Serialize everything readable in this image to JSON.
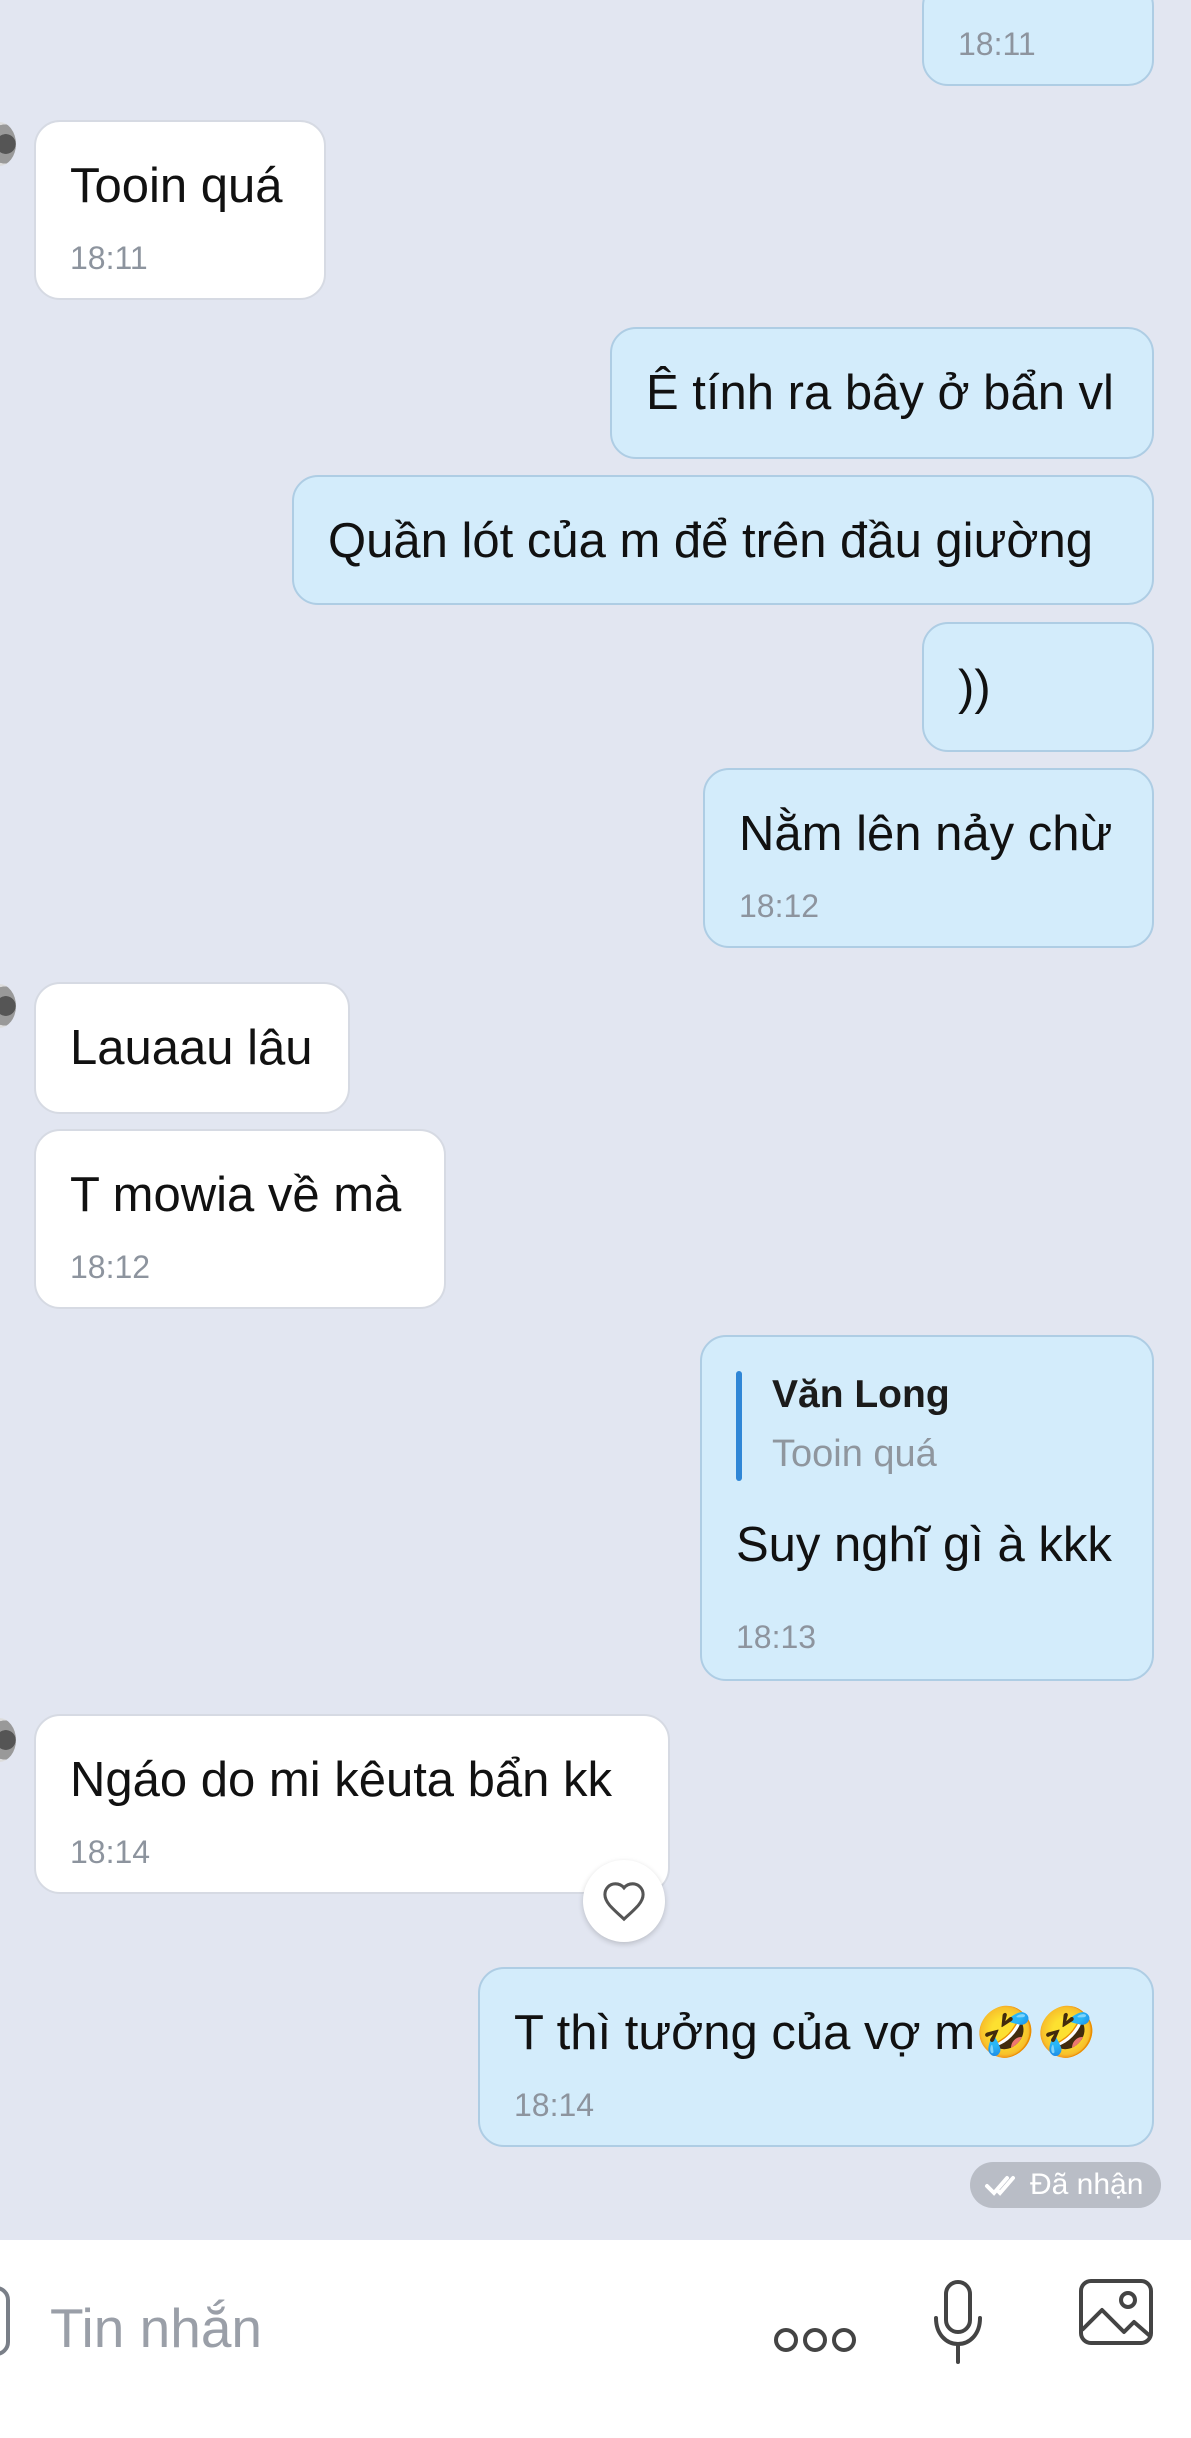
{
  "messages": [
    {
      "dir": "out",
      "time": "18:11"
    },
    {
      "dir": "in",
      "text": "Tooin quá",
      "time": "18:11"
    },
    {
      "dir": "out",
      "text": "Ê tính ra bây ở bẩn vl"
    },
    {
      "dir": "out",
      "text": "Quần lót của m để trên đầu giường"
    },
    {
      "dir": "out",
      "text": "))"
    },
    {
      "dir": "out",
      "text": "Nằm lên nảy chừ",
      "time": "18:12"
    },
    {
      "dir": "in",
      "text": "Lauaau lâu"
    },
    {
      "dir": "in",
      "text": "T mowia về mà",
      "time": "18:12"
    },
    {
      "dir": "out",
      "quote": {
        "name": "Văn Long",
        "text": "Tooin quá"
      },
      "text": "Suy nghĩ gì à kkk",
      "time": "18:13"
    },
    {
      "dir": "in",
      "text": "Ngáo do mi kêuta bẩn kk",
      "time": "18:14"
    },
    {
      "dir": "out",
      "text": "T thì tưởng của vợ m🤣🤣",
      "time": "18:14"
    }
  ],
  "status": {
    "label": "Đã nhận"
  },
  "composer": {
    "placeholder": "Tin nhắn"
  },
  "icons": {
    "more": "more-dots-icon",
    "mic": "microphone-icon",
    "image": "image-icon",
    "reaction": "heart-icon",
    "read": "double-check-icon"
  },
  "colors": {
    "background": "#e2e6f1",
    "incoming": "#ffffff",
    "outgoing": "#d3ecfb",
    "quote_bar": "#2f86d6"
  }
}
